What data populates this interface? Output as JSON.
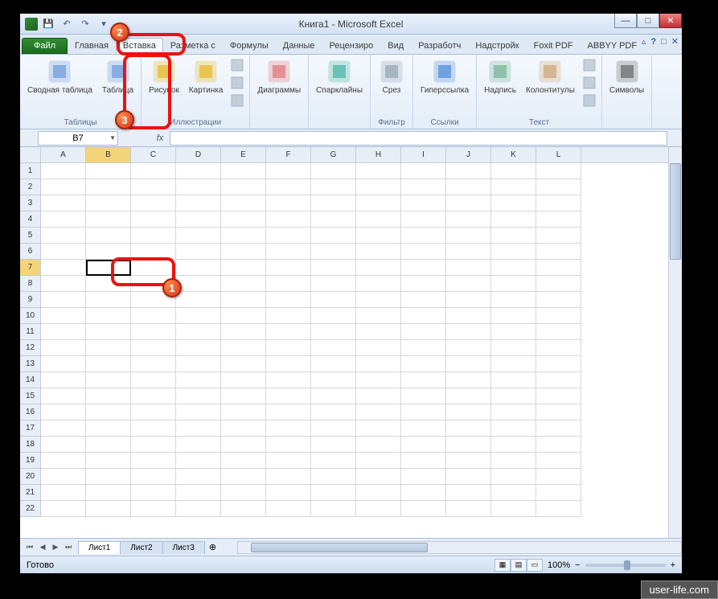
{
  "title": "Книга1 - Microsoft Excel",
  "tabs": {
    "file": "Файл",
    "items": [
      "Главная",
      "Вставка",
      "Разметка с",
      "Формулы",
      "Данные",
      "Рецензиро",
      "Вид",
      "Разработч",
      "Надстройк",
      "Foxit PDF",
      "ABBYY PDF"
    ],
    "active_index": 1
  },
  "ribbon": {
    "groups": [
      {
        "label": "Таблицы",
        "buttons": [
          {
            "k": "pivot",
            "label": "Сводная\nтаблица"
          },
          {
            "k": "table",
            "label": "Таблица"
          }
        ]
      },
      {
        "label": "Иллюстрации",
        "buttons": [
          {
            "k": "picture",
            "label": "Рисунок"
          },
          {
            "k": "clip",
            "label": "Картинка"
          }
        ],
        "small": [
          "shapes",
          "smartart",
          "screenshot"
        ]
      },
      {
        "label": "",
        "buttons": [
          {
            "k": "charts",
            "label": "Диаграммы"
          }
        ]
      },
      {
        "label": "",
        "buttons": [
          {
            "k": "spark",
            "label": "Спарклайны"
          }
        ]
      },
      {
        "label": "Фильтр",
        "buttons": [
          {
            "k": "slicer",
            "label": "Срез"
          }
        ]
      },
      {
        "label": "Ссылки",
        "buttons": [
          {
            "k": "link",
            "label": "Гиперссылка"
          }
        ]
      },
      {
        "label": "Текст",
        "buttons": [
          {
            "k": "textbox",
            "label": "Надпись"
          },
          {
            "k": "headerfooter",
            "label": "Колонтитулы"
          }
        ],
        "small": [
          "wordart",
          "sig",
          "obj"
        ]
      },
      {
        "label": "",
        "buttons": [
          {
            "k": "symbol",
            "label": "Символы"
          }
        ]
      }
    ]
  },
  "namebox": "B7",
  "fx_label": "fx",
  "columns": [
    "A",
    "B",
    "C",
    "D",
    "E",
    "F",
    "G",
    "H",
    "I",
    "J",
    "K",
    "L"
  ],
  "rows": [
    1,
    2,
    3,
    4,
    5,
    6,
    7,
    8,
    9,
    10,
    11,
    12,
    13,
    14,
    15,
    16,
    17,
    18,
    19,
    20,
    21,
    22
  ],
  "active_cell": {
    "col": "B",
    "row": 7
  },
  "sheets": [
    "Лист1",
    "Лист2",
    "Лист3"
  ],
  "active_sheet": 0,
  "status": "Готово",
  "zoom": "100%",
  "watermark": "user-life.com",
  "callouts": {
    "1": "1",
    "2": "2",
    "3": "3"
  }
}
